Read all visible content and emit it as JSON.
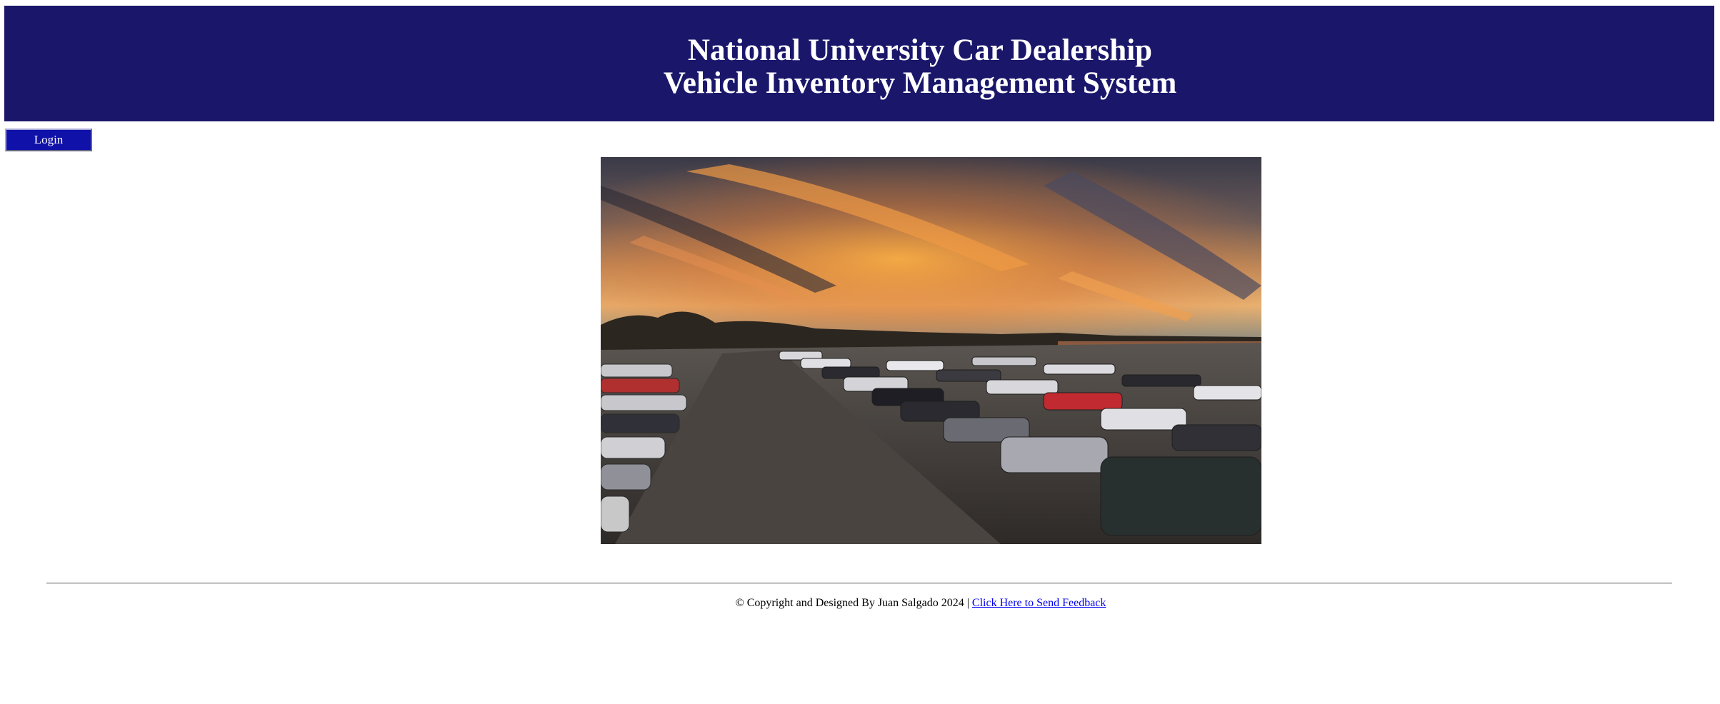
{
  "header": {
    "title_line1": "National University Car Dealership",
    "title_line2": "Vehicle Inventory Management System"
  },
  "login_label": "Login",
  "footer": {
    "copyright": "© Copyright and Designed By Juan Salgado 2024 | ",
    "feedback_link": "Click Here to Send Feedback"
  },
  "colors": {
    "header_bg": "#1a176b",
    "login_bg": "#1011a8",
    "link": "#0000ee"
  }
}
